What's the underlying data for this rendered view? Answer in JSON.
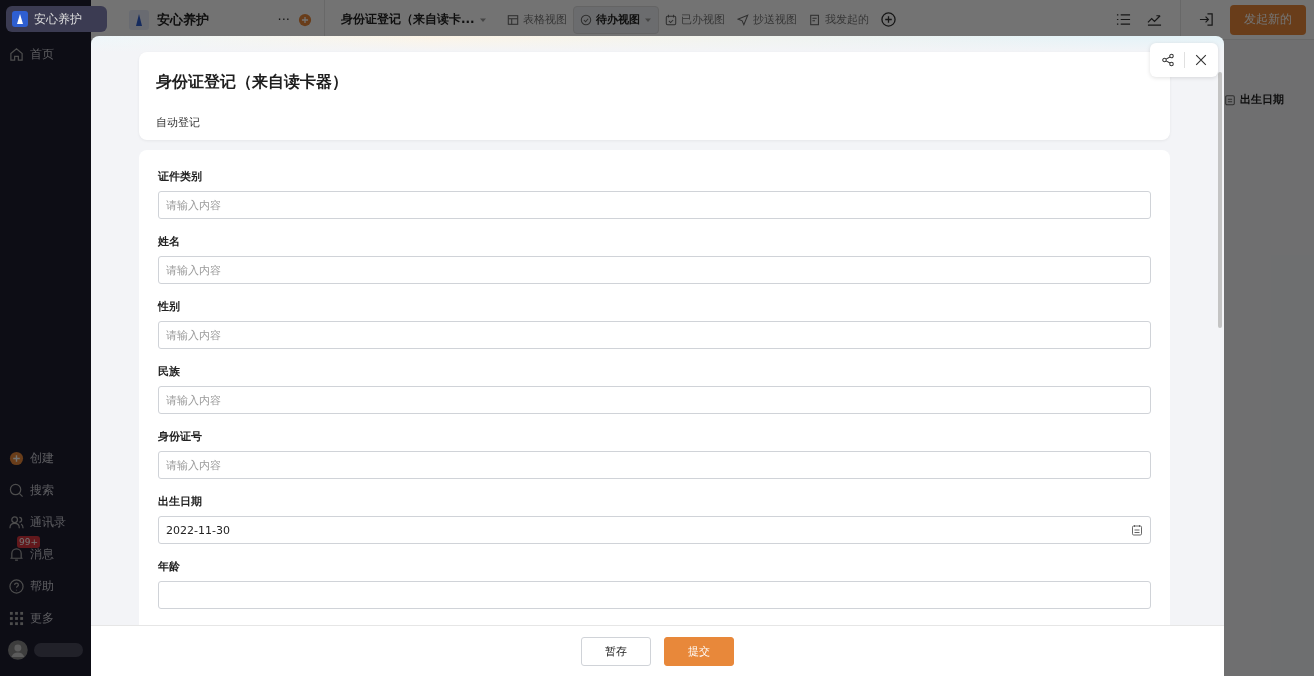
{
  "sidebar": {
    "workspace": "安心养护",
    "home": "首页",
    "items": [
      {
        "kind": "create",
        "label": "创建"
      },
      {
        "kind": "search",
        "label": "搜索"
      },
      {
        "kind": "contacts",
        "label": "通讯录"
      },
      {
        "kind": "bell",
        "label": "消息",
        "badge": "99+"
      },
      {
        "kind": "help",
        "label": "帮助"
      },
      {
        "kind": "more",
        "label": "更多"
      }
    ]
  },
  "topbar": {
    "app_name": "安心养护",
    "more": "···",
    "form_title": "身份证登记（来自读卡...",
    "tabs": [
      {
        "kind": "table",
        "label": "表格视图",
        "selected": false
      },
      {
        "kind": "todo",
        "label": "待办视图",
        "selected": true
      },
      {
        "kind": "done",
        "label": "已办视图",
        "selected": false
      },
      {
        "kind": "cc",
        "label": "抄送视图",
        "selected": false
      },
      {
        "kind": "mine",
        "label": "我发起的",
        "selected": false
      }
    ],
    "new_button": "发起新的"
  },
  "table": {
    "column_header": "出生日期"
  },
  "modal": {
    "title": "身份证登记（来自读卡器）",
    "description": "自动登记",
    "fields": [
      {
        "kind": "text",
        "label": "证件类别",
        "placeholder": "请输入内容"
      },
      {
        "kind": "text",
        "label": "姓名",
        "placeholder": "请输入内容"
      },
      {
        "kind": "text",
        "label": "性别",
        "placeholder": "请输入内容"
      },
      {
        "kind": "text",
        "label": "民族",
        "placeholder": "请输入内容"
      },
      {
        "kind": "text",
        "label": "身份证号",
        "placeholder": "请输入内容"
      },
      {
        "kind": "date",
        "label": "出生日期",
        "value": "2022-11-30"
      },
      {
        "kind": "text",
        "label": "年龄"
      }
    ],
    "buttons": [
      {
        "kind": "secondary",
        "label": "暂存"
      },
      {
        "kind": "primary",
        "label": "提交"
      }
    ]
  }
}
